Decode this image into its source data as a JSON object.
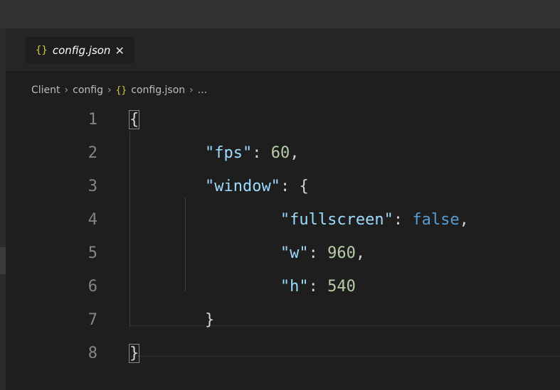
{
  "tab": {
    "icon": "{}",
    "label": "config.json",
    "close": "✕"
  },
  "breadcrumb": {
    "part1": "Client",
    "part2": "config",
    "icon": "{}",
    "part3": "config.json",
    "ellipsis": "...",
    "sep": "›"
  },
  "lines": [
    {
      "num": "1",
      "t0": "{"
    },
    {
      "num": "2",
      "key": "\"fps\"",
      "colon": ": ",
      "val": "60",
      "end": ","
    },
    {
      "num": "3",
      "key": "\"window\"",
      "colon": ": ",
      "end": "{"
    },
    {
      "num": "4",
      "key": "\"fullscreen\"",
      "colon": ": ",
      "val": "false",
      "end": ","
    },
    {
      "num": "5",
      "key": "\"w\"",
      "colon": ": ",
      "val": "960",
      "end": ","
    },
    {
      "num": "6",
      "key": "\"h\"",
      "colon": ": ",
      "val": "540"
    },
    {
      "num": "7",
      "t0": "}"
    },
    {
      "num": "8",
      "t0": "}"
    }
  ],
  "colors": {
    "key": "#9cdcfe",
    "number": "#b5cea8",
    "boolean": "#569cd6",
    "json_icon": "#cbcb41"
  }
}
